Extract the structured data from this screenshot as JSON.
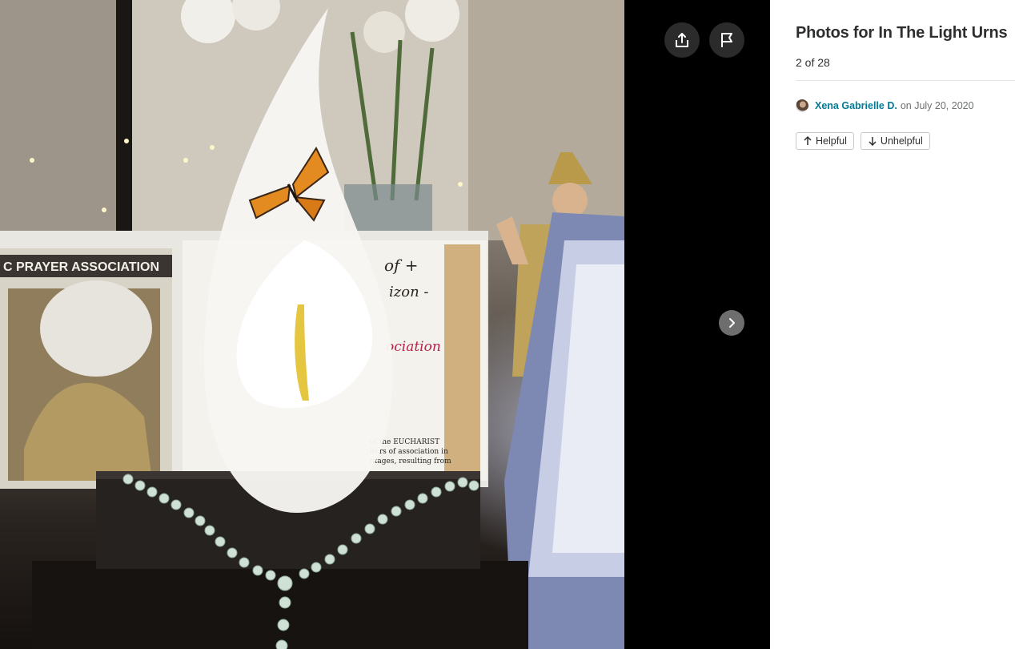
{
  "panel": {
    "title": "Photos for In The Light Urns",
    "counter": "2 of 28",
    "author": "Xena Gabrielle D.",
    "date_text": "on July 20, 2020",
    "helpful_label": "Helpful",
    "unhelpful_label": "Unhelpful"
  },
  "photo": {
    "certificate_heading": "C PRAYER ASSOCIATION",
    "certificate_line1": "of +",
    "certificate_line2": "izon -",
    "certificate_line3": "ociation",
    "certificate_body1": "of the EUCHARIST",
    "certificate_body2": "iters of association in",
    "certificate_body3": "ntages, resulting from"
  },
  "icons": {
    "share": "share-icon",
    "flag": "flag-icon",
    "next": "chevron-right-icon",
    "helpful": "arrow-up-icon",
    "unhelpful": "arrow-down-icon"
  },
  "colors": {
    "author_link": "#027a97",
    "viewer_background": "#000000",
    "title_text": "#2d2e2f"
  }
}
